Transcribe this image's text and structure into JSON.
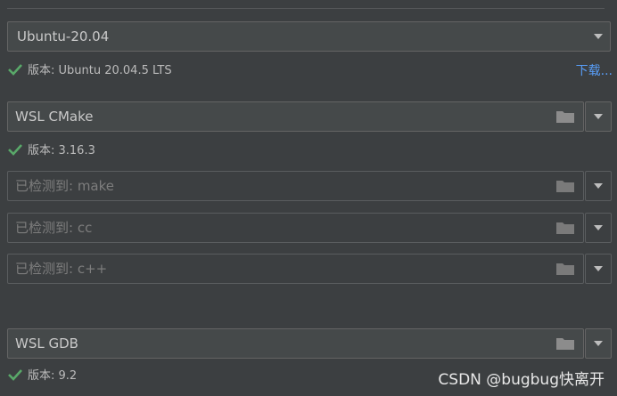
{
  "distribution": {
    "selected": "Ubuntu-20.04",
    "status": "版本: Ubuntu 20.04.5 LTS",
    "download_link": "下载..."
  },
  "cmake": {
    "value": "WSL CMake",
    "status": "版本: 3.16.3"
  },
  "make": {
    "placeholder": "已检测到: make"
  },
  "c_compiler": {
    "placeholder": "已检测到: cc"
  },
  "cpp_compiler": {
    "placeholder": "已检测到: c++"
  },
  "debugger": {
    "value": "WSL GDB",
    "status": "版本: 9.2"
  },
  "watermark": "CSDN @bugbug快离开",
  "colors": {
    "background": "#3c3f41",
    "check": "#59a869",
    "link": "#589df6"
  },
  "icons": [
    "check-icon",
    "folder-icon",
    "chevron-down-icon"
  ]
}
